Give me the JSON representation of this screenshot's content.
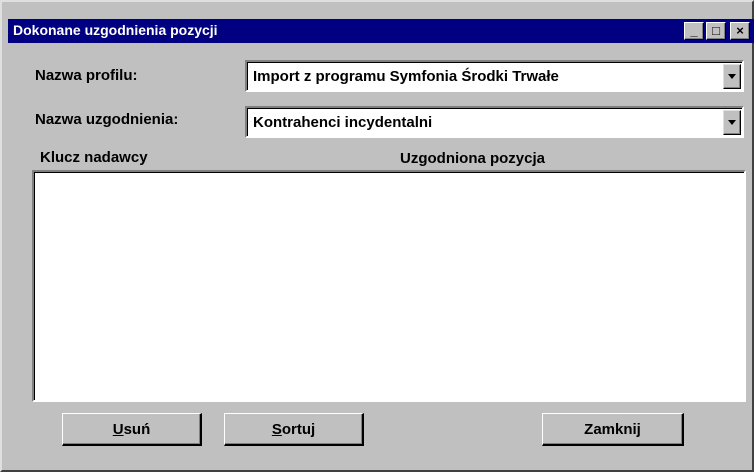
{
  "window": {
    "title": "Dokonane uzgodnienia pozycji",
    "controls": {
      "minimize": "_",
      "maximize": "□",
      "close": "×"
    }
  },
  "profile": {
    "label": "Nazwa profilu:",
    "value": "Import z programu Symfonia Środki Trwałe"
  },
  "agreement": {
    "label": "Nazwa uzgodnienia:",
    "value": "Kontrahenci incydentalni"
  },
  "list": {
    "columns": [
      "Klucz nadawcy",
      "Uzgodniona pozycja"
    ],
    "rows": []
  },
  "buttons": {
    "delete": {
      "mnemonic": "U",
      "rest": "suń"
    },
    "sort": {
      "mnemonic": "S",
      "rest": "ortuj"
    },
    "close": {
      "label": "Zamknij"
    }
  }
}
